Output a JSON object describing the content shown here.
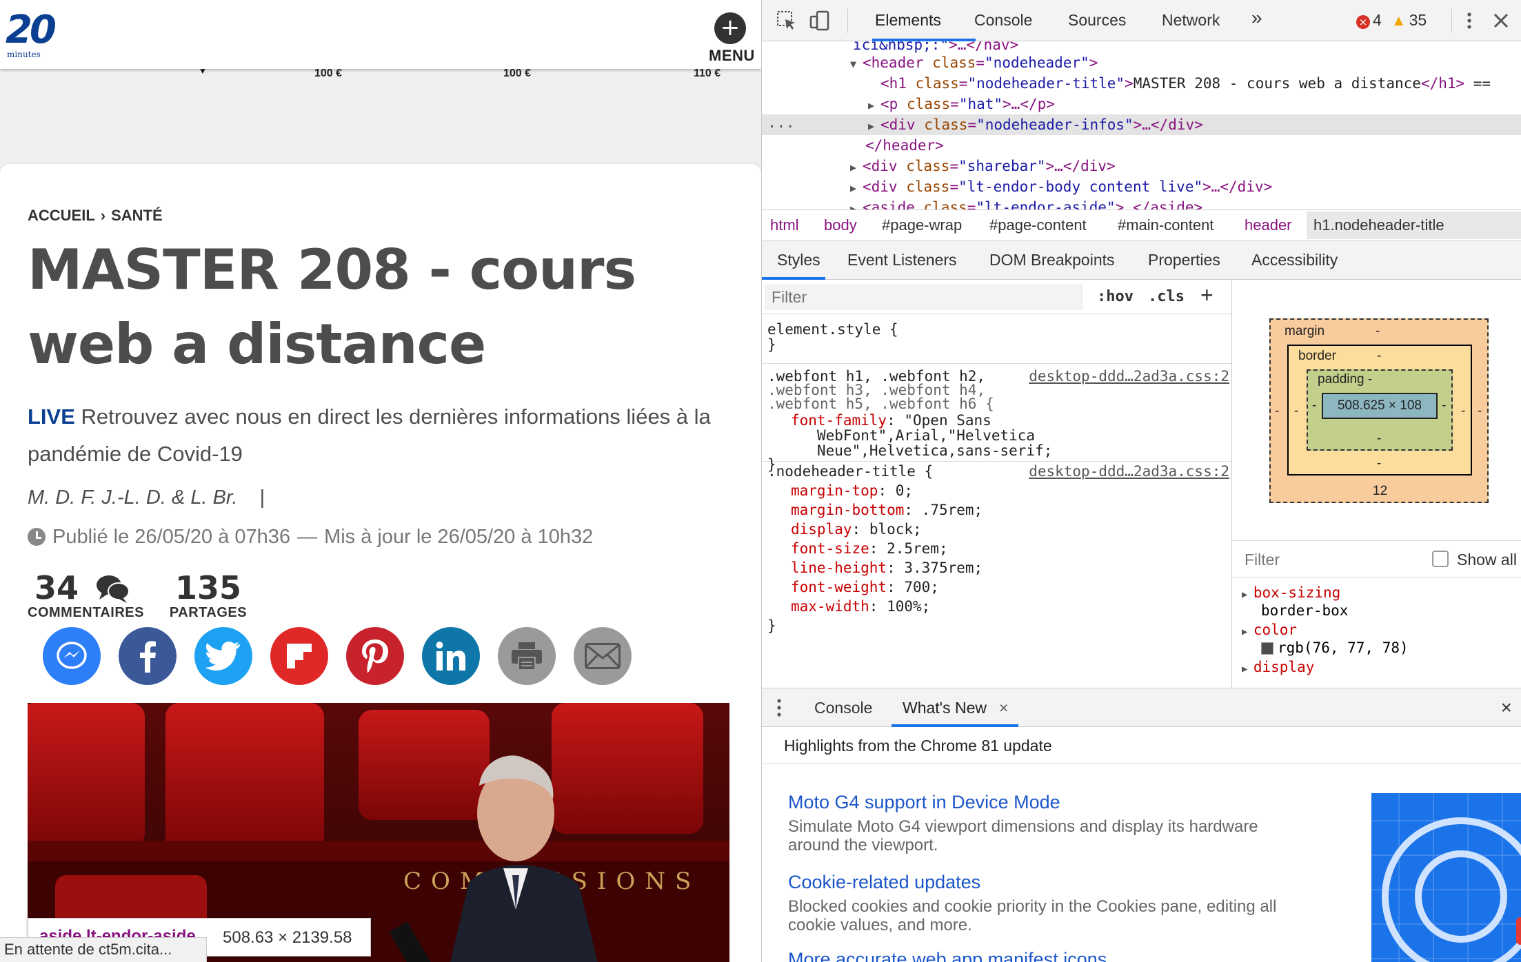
{
  "site": {
    "logo_number": "20",
    "logo_sub": "minutes",
    "menu_label": "MENU",
    "menu_plus": "+",
    "prices": [
      "100 €",
      "100 €",
      "110 €"
    ]
  },
  "article": {
    "breadcrumb": [
      "ACCUEIL",
      "SANTÉ"
    ],
    "breadcrumb_sep": "›",
    "title": "MASTER 208 - cours web a distance",
    "hat_live": "LIVE",
    "hat_text": "Retrouvez avec nous en direct les dernières informations liées à la pandémie de Covid-19",
    "authors": "M. D. F. J.-L. D. & L. Br.",
    "authors_sep": "|",
    "published": "Publié le 26/05/20 à 07h36",
    "dates_sep": "—",
    "updated": "Mis à jour le 26/05/20 à 10h32",
    "comments_count": "34",
    "comments_label": "COMMENTAIRES",
    "shares_count": "135",
    "shares_label": "PARTAGES",
    "share_buttons": [
      {
        "name": "messenger",
        "color": "#2d7ff9"
      },
      {
        "name": "facebook",
        "color": "#3b5998"
      },
      {
        "name": "twitter",
        "color": "#1da1f2"
      },
      {
        "name": "flipboard",
        "color": "#e12828"
      },
      {
        "name": "pinterest",
        "color": "#c8232c"
      },
      {
        "name": "linkedin",
        "color": "#0e76a8"
      },
      {
        "name": "print",
        "color": "#9a9a9a"
      },
      {
        "name": "email",
        "color": "#9a9a9a"
      }
    ],
    "photo_caption_text": "COMMISSIONS"
  },
  "inspector_tooltip": {
    "tag": "aside.lt-endor-aside",
    "dimensions": "508.63 × 2139.58"
  },
  "status_bar": "En attente de ct5m.cita...",
  "devtools": {
    "tabs": [
      "Elements",
      "Console",
      "Sources",
      "Network"
    ],
    "more_tabs": "»",
    "errors": "4",
    "warnings": "35",
    "dom_lines": [
      {
        "indent": 0,
        "tri": "",
        "tag_open": "ici&nbsp;:\">…</nav>",
        "kind": "text"
      },
      {
        "indent": 1,
        "tri": "▼",
        "tag": "header",
        "attr": "class",
        "val": "nodeheader",
        "tail": ">"
      },
      {
        "indent": 2,
        "tri": "",
        "tag": "h1",
        "attr": "class",
        "val": "nodeheader-title",
        "text": "MASTER 208 - cours web a distance",
        "close": "</h1>",
        "suffix": " =="
      },
      {
        "indent": 2,
        "tri": "▶",
        "tag": "p",
        "attr": "class",
        "val": "hat",
        "tail": ">…</p>"
      },
      {
        "indent": 2,
        "tri": "▶",
        "tag": "div",
        "attr": "class",
        "val": "nodeheader-infos",
        "tail": ">…</div>"
      },
      {
        "indent": 1,
        "tri": "",
        "closing": "</header>"
      },
      {
        "indent": 1,
        "tri": "▶",
        "tag": "div",
        "attr": "class",
        "val": "sharebar",
        "tail": ">…</div>"
      },
      {
        "indent": 1,
        "tri": "▶",
        "tag": "div",
        "attr": "class",
        "val": "lt-endor-body content live",
        "tail": ">…</div>"
      },
      {
        "indent": 1,
        "tri": "▶",
        "tag": "aside",
        "attr": "class",
        "val": "lt-endor-aside",
        "tail": ">…</aside>"
      }
    ],
    "dom_ellipsis": "...",
    "breadcrumbs": [
      "html",
      "body",
      "#page-wrap",
      "#page-content",
      "#main-content",
      "header",
      "h1.nodeheader-title"
    ],
    "sub_tabs": [
      "Styles",
      "Event Listeners",
      "DOM Breakpoints",
      "Properties",
      "Accessibility"
    ],
    "styles_filter_placeholder": "Filter",
    "hov": ":hov",
    "cls": ".cls",
    "add_rule": "+",
    "element_style": [
      "element.style {",
      "}"
    ],
    "rule1": {
      "selector_lines": [
        ".webfont h1, .webfont h2,",
        ".webfont h3, .webfont h4,",
        ".webfont h5, .webfont h6 {"
      ],
      "source": "desktop-ddd…2ad3a.css:2",
      "prop": "font-family",
      "value_lines": [
        "\"Open Sans",
        "WebFont\",Arial,\"Helvetica",
        "Neue\",Helvetica,sans-serif;"
      ],
      "close": "}"
    },
    "rule2": {
      "selector": ".nodeheader-title {",
      "source": "desktop-ddd…2ad3a.css:2",
      "props": [
        {
          "p": "margin-top",
          "v": "0;"
        },
        {
          "p": "margin-bottom",
          "v": ".75rem;"
        },
        {
          "p": "display",
          "v": "block;"
        },
        {
          "p": "font-size",
          "v": "2.5rem;"
        },
        {
          "p": "line-height",
          "v": "3.375rem;"
        },
        {
          "p": "font-weight",
          "v": "700;"
        },
        {
          "p": "max-width",
          "v": "100%;"
        }
      ],
      "close": "}"
    },
    "box_model": {
      "margin_label": "margin",
      "border_label": "border",
      "padding_label": "padding -",
      "content": "508.625 × 108",
      "dash": "-",
      "margin_bottom": "12"
    },
    "computed_filter_placeholder": "Filter",
    "show_all": "Show all",
    "computed": [
      {
        "prop": "box-sizing",
        "value": "border-box"
      },
      {
        "prop": "color",
        "value": "rgb(76, 77, 78)"
      },
      {
        "prop": "display",
        "value": ""
      }
    ],
    "drawer_tabs": [
      "Console",
      "What's New"
    ],
    "drawer_tab_close": "×",
    "drawer_close": "×",
    "whats_new_heading": "Highlights from the Chrome 81 update",
    "whats_new_items": [
      {
        "title": "Moto G4 support in Device Mode",
        "desc": "Simulate Moto G4 viewport dimensions and display its hardware around the viewport."
      },
      {
        "title": "Cookie-related updates",
        "desc": "Blocked cookies and cookie priority in the Cookies pane, editing all cookie values, and more."
      },
      {
        "title": "More accurate web app manifest icons",
        "desc": ""
      }
    ]
  }
}
